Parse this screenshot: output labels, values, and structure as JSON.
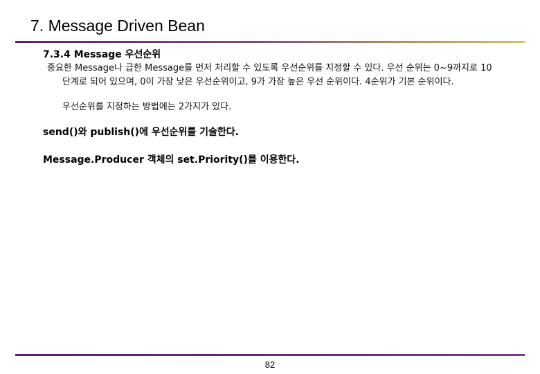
{
  "slide": {
    "title": "7. Message Driven Bean",
    "section_heading": "7.3.4 Message 우선순위",
    "paragraph1": "중요한 Message나 급한 Message를 먼저 처리할 수 있도록 우선순위를 지정할 수 있다. 우선 순위는 0~9까지로 10단계로 되어 있으며, 0이 가장 낮은 우선순위이고, 9가 가장 높은 우선 순위이다. 4순위가 기본 순위이다.",
    "paragraph2": "우선순위를 지정하는 방법에는 2가지가 있다.",
    "point1": "send()와 publish()에 우선순위를 기술한다.",
    "point2": "Message.Producer 객체의 set.Priority()를 이용한다.",
    "page_number": "82"
  }
}
